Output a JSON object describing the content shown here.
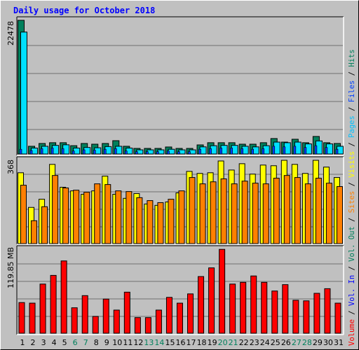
{
  "title": "Daily usage for October 2018",
  "legend": [
    {
      "label": "Volume",
      "color": "#ff0000"
    },
    {
      "label": "Vol. In",
      "color": "#0000ff"
    },
    {
      "label": "Vol. Out",
      "color": "#00805c"
    },
    {
      "label": "Sites",
      "color": "#ff8000"
    },
    {
      "label": "Visits",
      "color": "#ffff00"
    },
    {
      "label": "Pages",
      "color": "#00c0ff"
    },
    {
      "label": "Files",
      "color": "#0040ff"
    },
    {
      "label": "Hits",
      "color": "#00805c"
    }
  ],
  "chart_data": [
    {
      "type": "bar",
      "title": "Daily usage for October 2018",
      "panel": "hits-files-pages",
      "categories": [
        "1",
        "2",
        "3",
        "4",
        "5",
        "6",
        "7",
        "8",
        "9",
        "10",
        "11",
        "12",
        "13",
        "14",
        "15",
        "16",
        "17",
        "18",
        "19",
        "20",
        "21",
        "22",
        "23",
        "24",
        "25",
        "26",
        "27",
        "28",
        "29",
        "30",
        "31"
      ],
      "weekend_days": [
        "6",
        "7",
        "13",
        "14",
        "20",
        "21",
        "27",
        "28"
      ],
      "ymax_label": "22478",
      "ylim": [
        0,
        22478
      ],
      "grid": true,
      "series": [
        {
          "name": "Hits",
          "color": "#00805c",
          "values": [
            22478,
            1300,
            1770,
            1900,
            1900,
            1400,
            1770,
            1650,
            1770,
            2240,
            1300,
            940,
            940,
            940,
            1180,
            940,
            940,
            1530,
            1900,
            1900,
            1900,
            1650,
            1650,
            1900,
            2600,
            2000,
            2480,
            1900,
            2950,
            1900,
            1770
          ]
        },
        {
          "name": "Files",
          "color": "#00e0ff",
          "values": [
            20500,
            1000,
            1300,
            1450,
            1550,
            1000,
            1100,
            1050,
            1250,
            1300,
            1000,
            700,
            700,
            700,
            800,
            700,
            700,
            1200,
            1400,
            1450,
            1450,
            1300,
            1200,
            1400,
            2000,
            1900,
            2000,
            1700,
            2200,
            1700,
            1300
          ]
        },
        {
          "name": "Pages",
          "color": "#0040ff",
          "values": [
            800,
            600,
            900,
            1000,
            900,
            500,
            700,
            650,
            800,
            900,
            500,
            400,
            400,
            400,
            500,
            400,
            400,
            800,
            900,
            1000,
            1000,
            900,
            800,
            900,
            1300,
            1200,
            1300,
            1100,
            1400,
            1100,
            800
          ]
        }
      ]
    },
    {
      "type": "bar",
      "panel": "visits-sites",
      "categories": [
        "1",
        "2",
        "3",
        "4",
        "5",
        "6",
        "7",
        "8",
        "9",
        "10",
        "11",
        "12",
        "13",
        "14",
        "15",
        "16",
        "17",
        "18",
        "19",
        "20",
        "21",
        "22",
        "23",
        "24",
        "25",
        "26",
        "27",
        "28",
        "29",
        "30",
        "31"
      ],
      "ymax_label": "368",
      "ylim": [
        0,
        368
      ],
      "grid": true,
      "series": [
        {
          "name": "Visits",
          "color": "#ffff00",
          "values": [
            313,
            160,
            196,
            350,
            249,
            233,
            218,
            233,
            298,
            218,
            200,
            221,
            175,
            169,
            184,
            224,
            319,
            310,
            313,
            365,
            325,
            353,
            307,
            347,
            344,
            368,
            350,
            310,
            368,
            338,
            292
          ]
        },
        {
          "name": "Sites",
          "color": "#ff8000",
          "values": [
            258,
            101,
            163,
            301,
            246,
            236,
            227,
            264,
            261,
            233,
            230,
            203,
            190,
            181,
            196,
            233,
            292,
            264,
            273,
            286,
            264,
            276,
            267,
            264,
            289,
            301,
            292,
            264,
            289,
            267,
            252
          ]
        }
      ]
    },
    {
      "type": "bar",
      "panel": "volume",
      "categories": [
        "1",
        "2",
        "3",
        "4",
        "5",
        "6",
        "7",
        "8",
        "9",
        "10",
        "11",
        "12",
        "13",
        "14",
        "15",
        "16",
        "17",
        "18",
        "19",
        "20",
        "21",
        "22",
        "23",
        "24",
        "25",
        "26",
        "27",
        "28",
        "29",
        "30",
        "31"
      ],
      "ymax_label": "119.85 MB",
      "ylabel": "MB",
      "ylim": [
        0,
        150
      ],
      "reference_value": 119.85,
      "grid": true,
      "series": [
        {
          "name": "Volume",
          "color": "#ff0000",
          "values": [
            53,
            52,
            85,
            100,
            125,
            44,
            65,
            29,
            59,
            40,
            71,
            27,
            27,
            40,
            62,
            52,
            68,
            98,
            113,
            145,
            85,
            88,
            99,
            88,
            73,
            84,
            57,
            56,
            69,
            77,
            52
          ]
        }
      ]
    }
  ]
}
